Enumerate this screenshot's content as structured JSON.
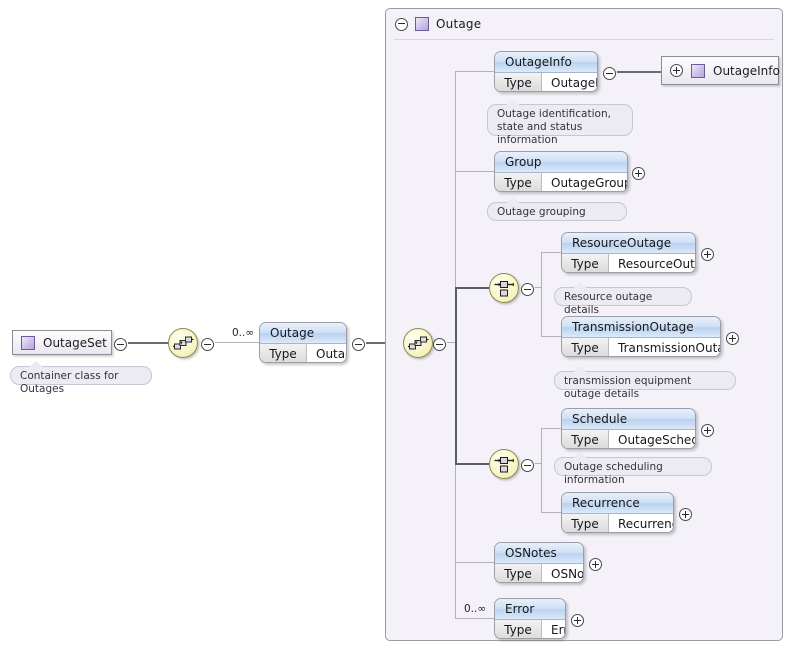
{
  "diagram": {
    "type": "xml-schema-tree",
    "root": {
      "name": "OutageSet",
      "icon": "class-glyph-icon",
      "annotation": "Container class for Outages",
      "expander": "minus"
    },
    "root_sequence": {
      "icon": "sequence-compositor-icon",
      "expander": "minus"
    },
    "outage_element": {
      "name": "Outage",
      "type_label": "Type",
      "type_value": "Outage",
      "cardinality": "0..∞",
      "expander": "minus"
    },
    "outage_group": {
      "title": "Outage",
      "icon": "class-glyph-icon",
      "expander": "minus"
    },
    "outage_sequence": {
      "icon": "sequence-compositor-icon",
      "expander": "minus"
    },
    "children": [
      {
        "name": "OutageInfo",
        "type_label": "Type",
        "type_value": "OutageInfo",
        "expander": "minus",
        "annotation": "Outage identification, state and status information",
        "reference": {
          "name": "OutageInfo",
          "expander": "plus",
          "icon": "class-glyph-icon"
        }
      },
      {
        "name": "Group",
        "type_label": "Type",
        "type_value": "OutageGrouping",
        "expander": "plus",
        "annotation": "Outage grouping"
      },
      {
        "name": "ResourceOutage",
        "type_label": "Type",
        "type_value": "ResourceOutage",
        "expander": "plus",
        "annotation": "Resource outage details"
      },
      {
        "name": "TransmissionOutage",
        "type_label": "Type",
        "type_value": "TransmissionOutage",
        "expander": "plus",
        "annotation": "transmission equipment outage details"
      },
      {
        "name": "Schedule",
        "type_label": "Type",
        "type_value": "OutageSchedule",
        "expander": "plus",
        "annotation": "Outage scheduling information"
      },
      {
        "name": "Recurrence",
        "type_label": "Type",
        "type_value": "Recurrence",
        "expander": "plus",
        "annotation": ""
      },
      {
        "name": "OSNotes",
        "type_label": "Type",
        "type_value": "OSNotes",
        "expander": "plus",
        "annotation": ""
      },
      {
        "name": "Error",
        "type_label": "Type",
        "type_value": "Error",
        "expander": "plus",
        "cardinality": "0..∞",
        "annotation": ""
      }
    ],
    "choice_nodes": [
      {
        "id": "choice-resource-transmission",
        "icon": "choice-compositor-icon",
        "expander": "minus"
      },
      {
        "id": "choice-schedule-recurrence",
        "icon": "choice-compositor-icon",
        "expander": "minus"
      }
    ],
    "colors": {
      "panel_background": "#f4f2f8",
      "panel_border": "#9a9aa2",
      "element_header": "#cfe0f6",
      "compositor_fill": "#f8f5c8",
      "glyph_purple": "#b8a8de",
      "connector": "#b4b0bd",
      "connector_required": "#5d5d66"
    }
  }
}
